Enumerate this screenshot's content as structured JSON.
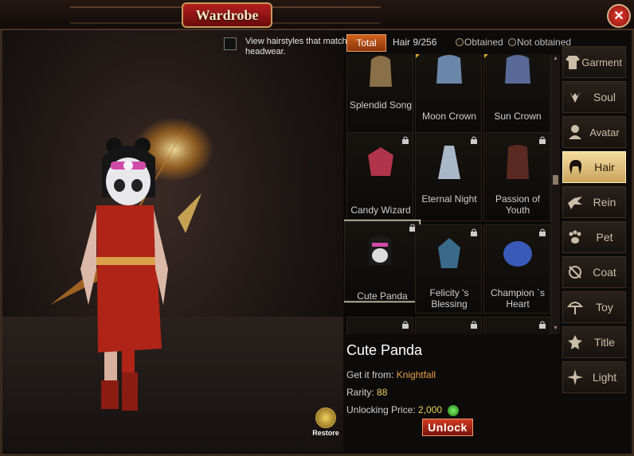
{
  "window": {
    "title": "Wardrobe",
    "close_label": "✕"
  },
  "preview": {
    "hair_toggle_label": "View hairstyles that match the headwear.",
    "restore_label": "Restore"
  },
  "filters": {
    "total_label": "Total",
    "hair_count": "Hair 9/256",
    "obtained_label": "Obtained",
    "not_obtained_label": "Not obtained"
  },
  "items": [
    {
      "name": "Splendid Song",
      "locked": false,
      "corner": false
    },
    {
      "name": "Moon Crown",
      "locked": false,
      "corner": true
    },
    {
      "name": "Sun Crown",
      "locked": false,
      "corner": true
    },
    {
      "name": "Candy Wizard",
      "locked": true,
      "corner": false
    },
    {
      "name": "Eternal Night",
      "locked": true,
      "corner": false
    },
    {
      "name": "Passion of Youth",
      "locked": true,
      "corner": false
    },
    {
      "name": "Cute Panda",
      "locked": true,
      "corner": false,
      "selected": true
    },
    {
      "name": "Felicity 's Blessing",
      "locked": true,
      "corner": false
    },
    {
      "name": "Champion `s Heart",
      "locked": true,
      "corner": false
    }
  ],
  "tabs": [
    {
      "label": "Garment",
      "icon": "garment-icon"
    },
    {
      "label": "Soul",
      "icon": "soul-icon"
    },
    {
      "label": "Avatar",
      "icon": "avatar-icon"
    },
    {
      "label": "Hair",
      "icon": "hair-icon",
      "active": true
    },
    {
      "label": "Rein",
      "icon": "rein-icon"
    },
    {
      "label": "Pet",
      "icon": "paw-icon"
    },
    {
      "label": "Coat",
      "icon": "coat-icon"
    },
    {
      "label": "Toy",
      "icon": "toy-icon"
    },
    {
      "label": "Title",
      "icon": "title-icon"
    },
    {
      "label": "Light",
      "icon": "light-icon"
    }
  ],
  "details": {
    "name": "Cute Panda",
    "source_label": "Get it from:",
    "source_value": "Knightfall",
    "rarity_label": "Rarity:",
    "rarity_value": "88",
    "price_label": "Unlocking Price:",
    "price_value": "2,000",
    "unlock_label": "Unlock"
  },
  "colors": {
    "accent": "#d0621e",
    "title_red": "#b51f1f",
    "active_tab": "#f3dca0",
    "source_orange": "#e6a04a"
  }
}
